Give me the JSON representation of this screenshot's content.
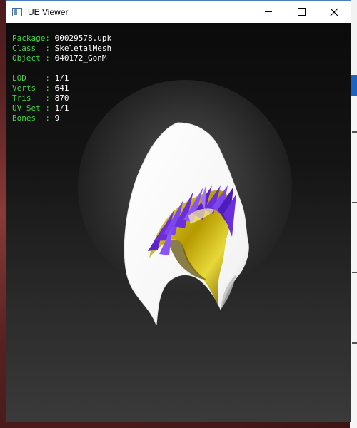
{
  "window": {
    "title": "UE Viewer",
    "controls": {
      "minimize": "—",
      "maximize": "☐",
      "close": "✕"
    }
  },
  "info": {
    "package_label": "Package:",
    "package_value": "00029578.upk",
    "class_label": "Class  :",
    "class_value": "SkeletalMesh",
    "object_label": "Object :",
    "object_value": "040172_GonM",
    "lod_label": "LOD    :",
    "lod_value": "1/1",
    "verts_label": "Verts  :",
    "verts_value": "641",
    "tris_label": "Tris   :",
    "tris_value": "870",
    "uvset_label": "UV Set :",
    "uvset_value": "1/1",
    "bones_label": "Bones  :",
    "bones_value": "9"
  },
  "colors": {
    "label_green": "#3fd53f",
    "value_white": "#ffffff",
    "hood_white": "#ffffff",
    "hood_gold": "#c8b200",
    "hair_purple": "#6a2fd8"
  },
  "icons": {
    "app": "app-window-icon",
    "minimize": "minimize-icon",
    "maximize": "maximize-icon",
    "close": "close-icon"
  }
}
